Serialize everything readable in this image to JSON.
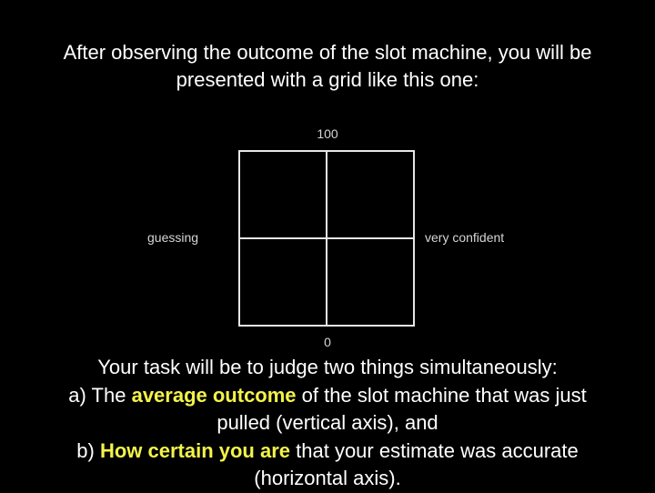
{
  "intro": {
    "line1": "After observing the outcome of the slot machine, you will be",
    "line2": "presented with a grid like this one:"
  },
  "grid": {
    "top_label": "100",
    "bottom_label": "0",
    "left_label": "guessing",
    "right_label": "very confident"
  },
  "task": {
    "line1": "Your task will be to judge two things simultaneously:",
    "a_prefix": "a) The ",
    "a_highlight": "average outcome",
    "a_suffix": " of the slot machine that was just",
    "a_line2": "pulled (vertical axis), and",
    "b_prefix": "b) ",
    "b_highlight": "How certain you are",
    "b_suffix": " that your estimate was accurate",
    "b_line2": "(horizontal axis)."
  },
  "colors": {
    "background": "#000000",
    "text": "#ffffff",
    "highlight": "#f3f34a"
  }
}
